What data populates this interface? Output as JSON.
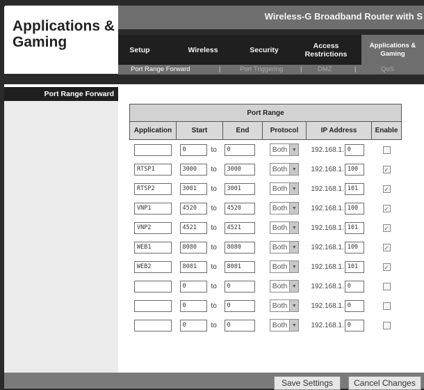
{
  "section_title": "Applications & Gaming",
  "product_name": "Wireless-G Broadband Router with S",
  "tabs": [
    {
      "label": "Setup",
      "active": false
    },
    {
      "label": "Wireless",
      "active": false
    },
    {
      "label": "Security",
      "active": false
    },
    {
      "label": "Access Restrictions",
      "active": false
    },
    {
      "label": "Applications & Gaming",
      "active": true
    }
  ],
  "subtabs": [
    {
      "label": "Port Range Forward",
      "active": true
    },
    {
      "label": "Port Triggering",
      "active": false
    },
    {
      "label": "DMZ",
      "active": false
    },
    {
      "label": "QoS",
      "active": false
    }
  ],
  "separator": "|",
  "left_nav": {
    "label": "Port Range Forward"
  },
  "table": {
    "title": "Port Range",
    "headers": {
      "application": "Application",
      "start": "Start",
      "end": "End",
      "protocol": "Protocol",
      "ip_address": "IP Address",
      "enable": "Enable"
    },
    "to_label": "to",
    "ip_prefix": "192.168.1.",
    "rows": [
      {
        "application": "",
        "start": "0",
        "end": "0",
        "protocol": "Both",
        "ip": "0",
        "enabled": false
      },
      {
        "application": "RTSP1",
        "start": "3000",
        "end": "3000",
        "protocol": "Both",
        "ip": "100",
        "enabled": true
      },
      {
        "application": "RTSP2",
        "start": "3001",
        "end": "3001",
        "protocol": "Both",
        "ip": "101",
        "enabled": true
      },
      {
        "application": "VNP1",
        "start": "4520",
        "end": "4520",
        "protocol": "Both",
        "ip": "100",
        "enabled": true
      },
      {
        "application": "VNP2",
        "start": "4521",
        "end": "4521",
        "protocol": "Both",
        "ip": "101",
        "enabled": true
      },
      {
        "application": "WEB1",
        "start": "8080",
        "end": "8080",
        "protocol": "Both",
        "ip": "100",
        "enabled": true
      },
      {
        "application": "WEB2",
        "start": "8081",
        "end": "8081",
        "protocol": "Both",
        "ip": "101",
        "enabled": true
      },
      {
        "application": "",
        "start": "0",
        "end": "0",
        "protocol": "Both",
        "ip": "0",
        "enabled": false
      },
      {
        "application": "",
        "start": "0",
        "end": "0",
        "protocol": "Both",
        "ip": "0",
        "enabled": false
      },
      {
        "application": "",
        "start": "0",
        "end": "0",
        "protocol": "Both",
        "ip": "0",
        "enabled": false
      }
    ]
  },
  "buttons": {
    "save": "Save Settings",
    "cancel": "Cancel Changes"
  },
  "icons": {
    "select_arrow": "chevron-down-icon",
    "checkmark": "check-icon"
  }
}
